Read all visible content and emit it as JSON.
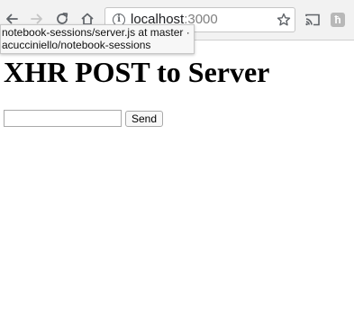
{
  "browser": {
    "url_host": "localhost",
    "url_port": ":3000",
    "icons": {
      "back": "back-arrow-icon",
      "forward": "forward-arrow-icon",
      "reload": "reload-icon",
      "home": "home-icon",
      "site_info": "info-icon",
      "bookmark": "star-icon",
      "cast": "cast-icon",
      "extension": "extension-icon"
    },
    "info_glyph": "i",
    "extension_glyph": "ћ"
  },
  "tooltip": {
    "line1": "notebook-sessions/server.js at master ·",
    "line2": "acucciniello/notebook-sessions"
  },
  "page": {
    "heading": "XHR POST to Server",
    "input_value": "",
    "send_label": "Send"
  },
  "colors": {
    "toolbar_bg": "#f2f2f2",
    "host_text": "#202124",
    "port_text": "#808080",
    "page_bg": "#ffffff"
  }
}
